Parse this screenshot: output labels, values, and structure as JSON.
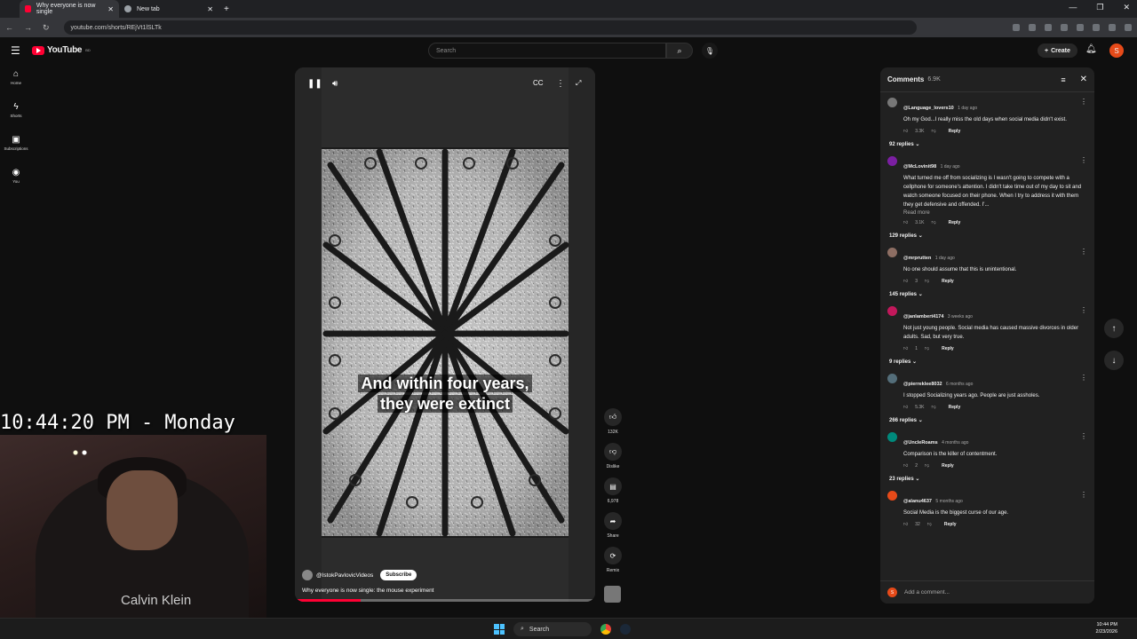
{
  "browser": {
    "tabs": [
      {
        "title": "Why everyone is now single",
        "active": true
      },
      {
        "title": "New tab",
        "active": false
      }
    ],
    "url": "youtube.com/shorts/REjVt1lSLTk"
  },
  "youtube": {
    "logo": "YouTube",
    "logo_sup": "BD",
    "search_placeholder": "Search",
    "create_label": "Create",
    "avatar_letter": "S",
    "sidebar": [
      {
        "label": "Home",
        "icon": "home-icon"
      },
      {
        "label": "Shorts",
        "icon": "shorts-icon"
      },
      {
        "label": "Subscriptions",
        "icon": "subscriptions-icon"
      },
      {
        "label": "You",
        "icon": "you-icon"
      }
    ]
  },
  "overlay": {
    "clock": "10:44:20 PM - Monday",
    "shirt_brand": "Calvin Klein"
  },
  "short": {
    "subtitle_line1": "And within four years,",
    "subtitle_line2": "they were extinct",
    "channel": "@IstokPavlovicVideos",
    "subscribe_label": "Subscribe",
    "title": "Why everyone is now single: the mouse experiment",
    "progress": 0.22,
    "actions": {
      "likes": "132K",
      "dislike": "Dislike",
      "comments": "6,978",
      "share": "Share",
      "remix": "Remix"
    }
  },
  "comments": {
    "title": "Comments",
    "count": "6.9K",
    "add_placeholder": "Add a comment...",
    "items": [
      {
        "author": "@Language_lovers10",
        "time": "1 day ago",
        "text": "Oh my God...I really miss the old days when social media didn't exist.",
        "likes": "3.3K",
        "replies": "92 replies",
        "avatar_color": "#777"
      },
      {
        "author": "@McLovinit98",
        "time": "1 day ago",
        "text": "What turned me off from socializing is I wasn't going to compete with a cellphone for someone's attention. I didn't take time out of my day to sit and watch someone focused on their phone. When I try to address it with them they get defensive and offended. I'...",
        "read_more": "Read more",
        "likes": "3.1K",
        "replies": "129 replies",
        "avatar_color": "#7b1fa2"
      },
      {
        "author": "@mrprutten",
        "time": "1 day ago",
        "text": "No one should assume that this is unintentional.",
        "likes": "3",
        "replies": "145 replies",
        "avatar_color": "#8d6e63"
      },
      {
        "author": "@janlambert4174",
        "time": "3 weeks ago",
        "text": "Not just young people. Social media has caused massive divorces in older adults. Sad, but very true.",
        "likes": "1",
        "replies": "9 replies",
        "avatar_color": "#c2185b"
      },
      {
        "author": "@pierreklee8032",
        "time": "6 months ago",
        "text": "I stopped Socializing years ago. People are just assholes.",
        "likes": "5.3K",
        "replies": "266 replies",
        "avatar_color": "#546e7a"
      },
      {
        "author": "@UncleRoams",
        "time": "4 months ago",
        "text": "Comparison is the killer of contentment.",
        "likes": "2",
        "replies": "23 replies",
        "avatar_color": "#00897b"
      },
      {
        "author": "@alanu4637",
        "time": "5 months ago",
        "text": "Social Media is the biggest curse of our age.",
        "likes": "32",
        "replies": "",
        "avatar_color": "#e64a19"
      }
    ],
    "reply_label": "Reply"
  },
  "taskbar": {
    "search": "Search",
    "time": "10:44 PM",
    "date": "2/23/2026"
  }
}
